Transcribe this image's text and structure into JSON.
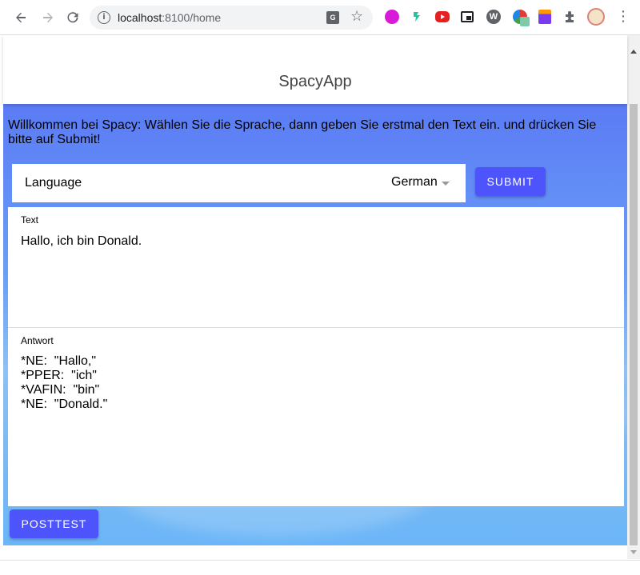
{
  "browser": {
    "url_host": "localhost",
    "url_port_path": ":8100/home",
    "back_icon": "arrow-back-icon",
    "forward_icon": "arrow-forward-icon",
    "reload_icon": "reload-icon",
    "info_icon": "site-info-icon",
    "translate_icon": "translate-icon",
    "bookmark_icon": "star-icon",
    "extensions": [
      "pink-circle-extension",
      "green-figure-extension",
      "youtube-extension",
      "picture-in-picture-extension",
      "w-extension",
      "color-circles-extension",
      "paint-bucket-extension",
      "puzzle-icon",
      "avatar-extension"
    ],
    "menu_icon": "kebab-menu-icon"
  },
  "app": {
    "title": "SpacyApp",
    "welcome": "Willkommen bei Spacy: Wählen Sie die Sprache, dann geben Sie erstmal den Text ein. und drücken Sie bitte auf Submit!",
    "language_label": "Language",
    "language_value": "German",
    "submit_label": "SUBMIT",
    "text_label": "Text",
    "text_value": "Hallo, ich bin Donald.",
    "answer_label": "Antwort",
    "answer_value": "*NE:  \"Hallo,\"\n*PPER:  \"ich\"\n*VAFIN:  \"bin\"\n*NE:  \"Donald.\"",
    "posttest_label": "POSTTEST"
  },
  "colors": {
    "accent": "#4d54fb",
    "background_top": "#5b7bf5",
    "background_bottom": "#6bb6f8"
  }
}
